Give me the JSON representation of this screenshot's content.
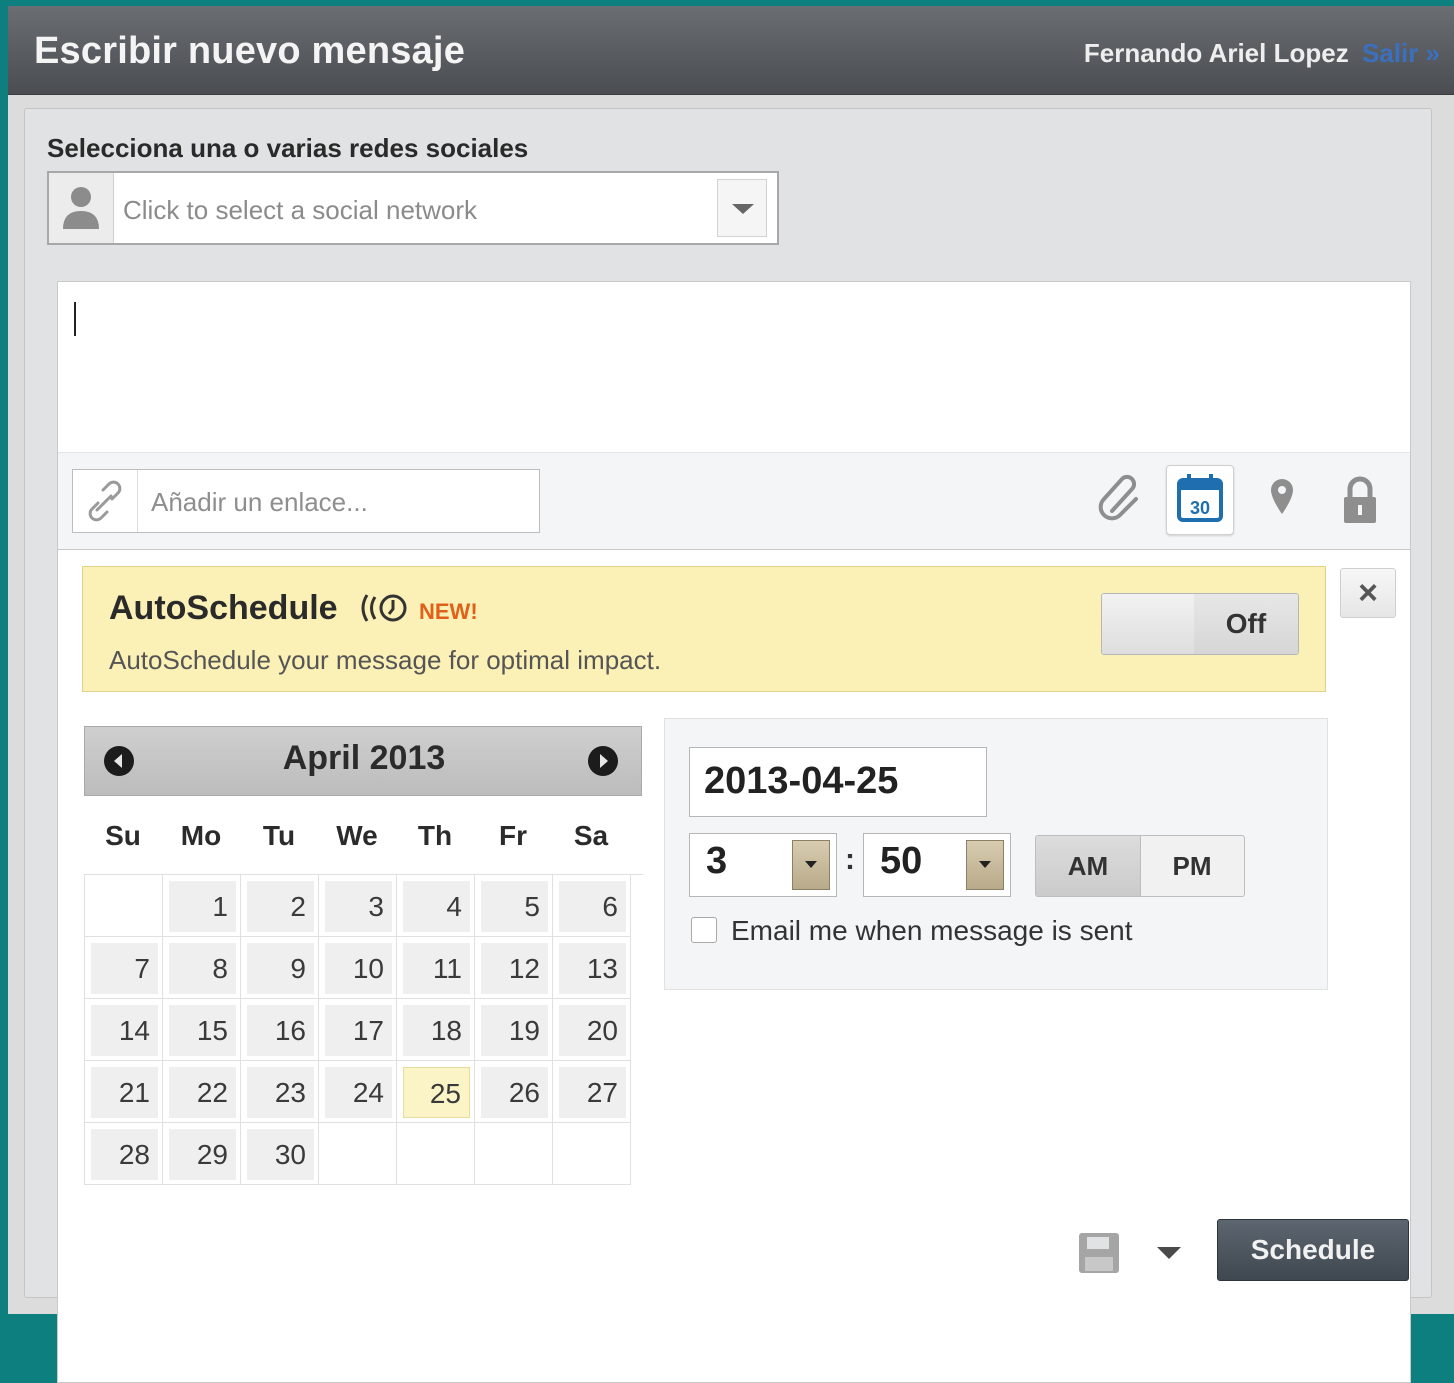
{
  "header": {
    "title": "Escribir nuevo mensaje",
    "user_name": "Fernando Ariel Lopez",
    "logout": "Salir »"
  },
  "networks": {
    "label": "Selecciona una o varias redes sociales",
    "placeholder": "Click to select a social network"
  },
  "composer": {
    "text": "",
    "link_placeholder": "Añadir un enlace...",
    "tools": [
      "attach-icon",
      "calendar-icon",
      "location-icon",
      "lock-icon"
    ],
    "calendar_icon_number": "30"
  },
  "autoschedule": {
    "title": "AutoSchedule",
    "badge": "NEW!",
    "description": "AutoSchedule your message for optimal impact.",
    "toggle_label": "Off",
    "close": "×"
  },
  "calendar": {
    "month": "April",
    "year": "2013",
    "weekdays": [
      "Su",
      "Mo",
      "Tu",
      "We",
      "Th",
      "Fr",
      "Sa"
    ],
    "days": [
      "1",
      "2",
      "3",
      "4",
      "5",
      "6",
      "7",
      "8",
      "9",
      "10",
      "11",
      "12",
      "13",
      "14",
      "15",
      "16",
      "17",
      "18",
      "19",
      "20",
      "21",
      "22",
      "23",
      "24",
      "25",
      "26",
      "27",
      "28",
      "29",
      "30"
    ],
    "first_weekday_index": 1,
    "selected_day": "25"
  },
  "schedule": {
    "date": "2013-04-25",
    "hour": "3",
    "minute": "50",
    "separator": ":",
    "am": "AM",
    "pm": "PM",
    "selected_period": "AM",
    "email_label": "Email me when message is sent",
    "email_checked": false
  },
  "footer": {
    "schedule_button": "Schedule"
  },
  "colors": {
    "background": "#0e7f7f",
    "titlebar": "#55595d",
    "logout_link": "#3d6fbf",
    "banner": "#fbf1b6",
    "new_badge": "#e0601a",
    "selected_day": "#faf4c6",
    "schedule_button": "#4a525b"
  }
}
